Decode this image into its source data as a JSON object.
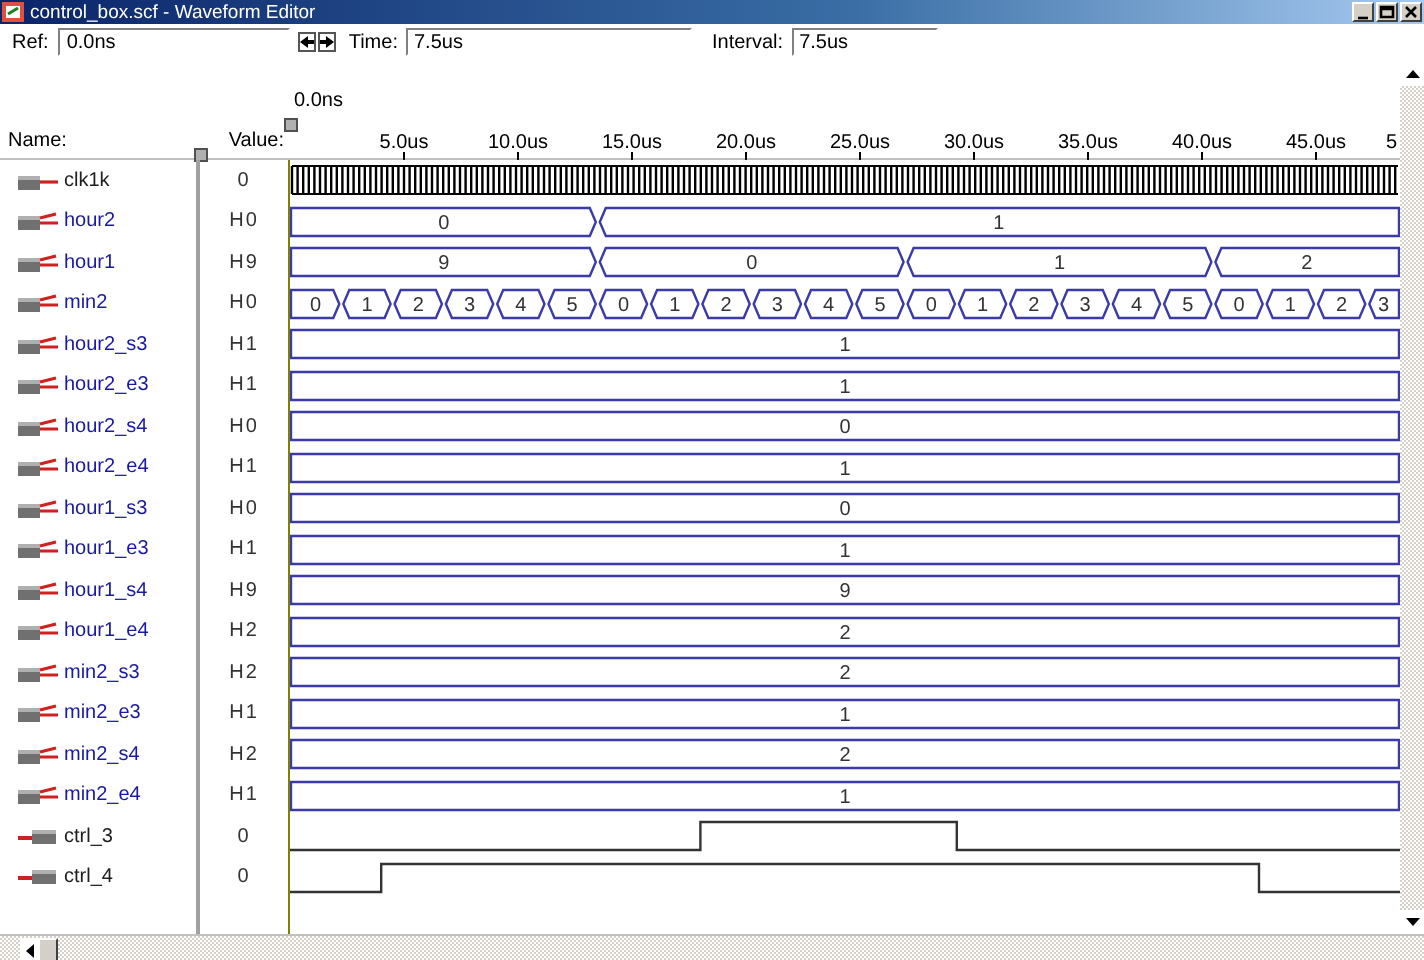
{
  "window": {
    "title": "control_box.scf - Waveform Editor"
  },
  "toolbar": {
    "ref_label": "Ref:",
    "ref": "0.0ns",
    "time_label": "Time:",
    "time": "7.5us",
    "interval_label": "Interval:",
    "interval": "7.5us"
  },
  "header": {
    "name_label": "Name:",
    "value_label": "Value:",
    "cursor_label": "0.0ns",
    "ticks": [
      "5.0us",
      "10.0us",
      "15.0us",
      "20.0us",
      "25.0us",
      "30.0us",
      "35.0us",
      "40.0us",
      "45.0us",
      "5"
    ]
  },
  "signals": [
    {
      "name": "clk1k",
      "value": "0",
      "kind": "clock"
    },
    {
      "name": "hour2",
      "value": "H0",
      "kind": "bus",
      "segments": [
        "0",
        "1"
      ]
    },
    {
      "name": "hour1",
      "value": "H9",
      "kind": "bus",
      "segments": [
        "9",
        "0",
        "1",
        "2"
      ]
    },
    {
      "name": "min2",
      "value": "H0",
      "kind": "bus",
      "segments": [
        "0",
        "1",
        "2",
        "3",
        "4",
        "5",
        "0",
        "1",
        "2",
        "3",
        "4",
        "5",
        "0",
        "1",
        "2",
        "3",
        "4",
        "5",
        "0",
        "1",
        "2",
        "3"
      ]
    },
    {
      "name": "hour2_s3",
      "value": "H1",
      "kind": "bus",
      "segments": [
        "1"
      ]
    },
    {
      "name": "hour2_e3",
      "value": "H1",
      "kind": "bus",
      "segments": [
        "1"
      ]
    },
    {
      "name": "hour2_s4",
      "value": "H0",
      "kind": "bus",
      "segments": [
        "0"
      ]
    },
    {
      "name": "hour2_e4",
      "value": "H1",
      "kind": "bus",
      "segments": [
        "1"
      ]
    },
    {
      "name": "hour1_s3",
      "value": "H0",
      "kind": "bus",
      "segments": [
        "0"
      ]
    },
    {
      "name": "hour1_e3",
      "value": "H1",
      "kind": "bus",
      "segments": [
        "1"
      ]
    },
    {
      "name": "hour1_s4",
      "value": "H9",
      "kind": "bus",
      "segments": [
        "9"
      ]
    },
    {
      "name": "hour1_e4",
      "value": "H2",
      "kind": "bus",
      "segments": [
        "2"
      ]
    },
    {
      "name": "min2_s3",
      "value": "H2",
      "kind": "bus",
      "segments": [
        "2"
      ]
    },
    {
      "name": "min2_e3",
      "value": "H1",
      "kind": "bus",
      "segments": [
        "1"
      ]
    },
    {
      "name": "min2_s4",
      "value": "H2",
      "kind": "bus",
      "segments": [
        "2"
      ]
    },
    {
      "name": "min2_e4",
      "value": "H1",
      "kind": "bus",
      "segments": [
        "1"
      ]
    },
    {
      "name": "ctrl_3",
      "value": "0",
      "kind": "bit"
    },
    {
      "name": "ctrl_4",
      "value": "0",
      "kind": "bit"
    }
  ]
}
